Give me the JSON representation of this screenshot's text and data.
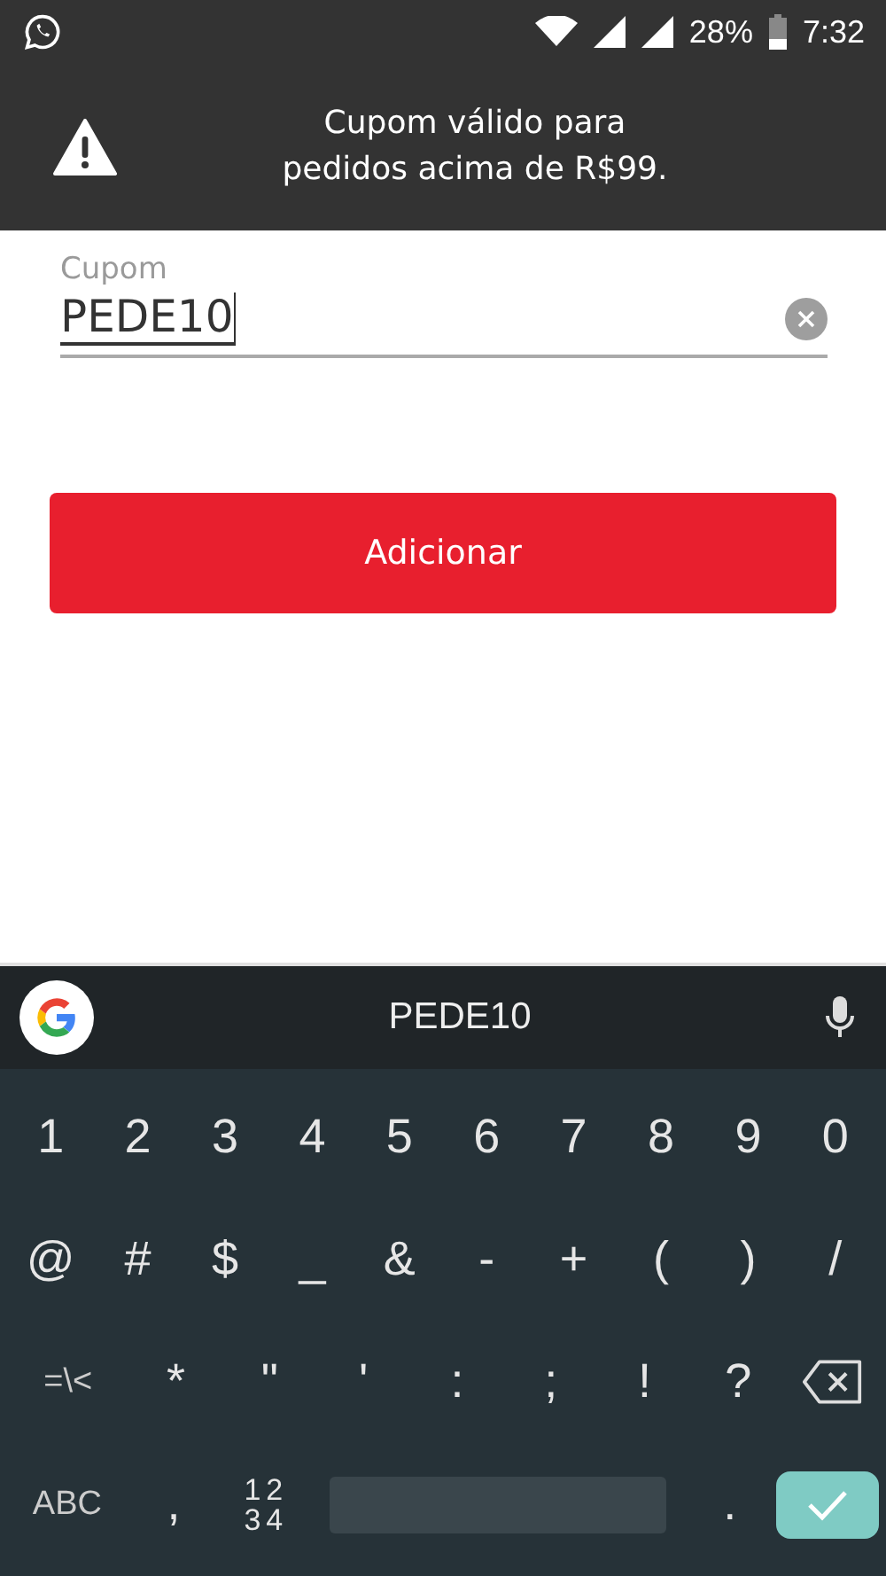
{
  "status_bar": {
    "battery": "28%",
    "time": "7:32"
  },
  "banner": {
    "message": "Cupom válido para\npedidos acima de R$99."
  },
  "coupon_field": {
    "label": "Cupom",
    "value": "PEDE10"
  },
  "add_button": {
    "label": "Adicionar"
  },
  "keyboard": {
    "suggestion": "PEDE10",
    "rows": [
      [
        {
          "kind": "char",
          "label": "1"
        },
        {
          "kind": "char",
          "label": "2"
        },
        {
          "kind": "char",
          "label": "3"
        },
        {
          "kind": "char",
          "label": "4"
        },
        {
          "kind": "char",
          "label": "5"
        },
        {
          "kind": "char",
          "label": "6"
        },
        {
          "kind": "char",
          "label": "7"
        },
        {
          "kind": "char",
          "label": "8"
        },
        {
          "kind": "char",
          "label": "9"
        },
        {
          "kind": "char",
          "label": "0"
        }
      ],
      [
        {
          "kind": "char",
          "label": "@"
        },
        {
          "kind": "char",
          "label": "#"
        },
        {
          "kind": "char",
          "label": "$"
        },
        {
          "kind": "char",
          "label": "_"
        },
        {
          "kind": "char",
          "label": "&"
        },
        {
          "kind": "char",
          "label": "-"
        },
        {
          "kind": "char",
          "label": "+"
        },
        {
          "kind": "char",
          "label": "("
        },
        {
          "kind": "char",
          "label": ")"
        },
        {
          "kind": "char",
          "label": "/"
        }
      ],
      [
        {
          "kind": "mode",
          "label": "=\\<"
        },
        {
          "kind": "char",
          "label": "*"
        },
        {
          "kind": "char",
          "label": "\""
        },
        {
          "kind": "char",
          "label": "'"
        },
        {
          "kind": "char",
          "label": ":"
        },
        {
          "kind": "char",
          "label": ";"
        },
        {
          "kind": "char",
          "label": "!"
        },
        {
          "kind": "char",
          "label": "?"
        },
        {
          "kind": "backspace"
        }
      ],
      [
        {
          "kind": "mode",
          "label": "ABC"
        },
        {
          "kind": "char",
          "label": ","
        },
        {
          "kind": "numpad",
          "lines": [
            "12",
            "34"
          ]
        },
        {
          "kind": "space"
        },
        {
          "kind": "char",
          "label": "."
        },
        {
          "kind": "enter"
        }
      ]
    ]
  }
}
